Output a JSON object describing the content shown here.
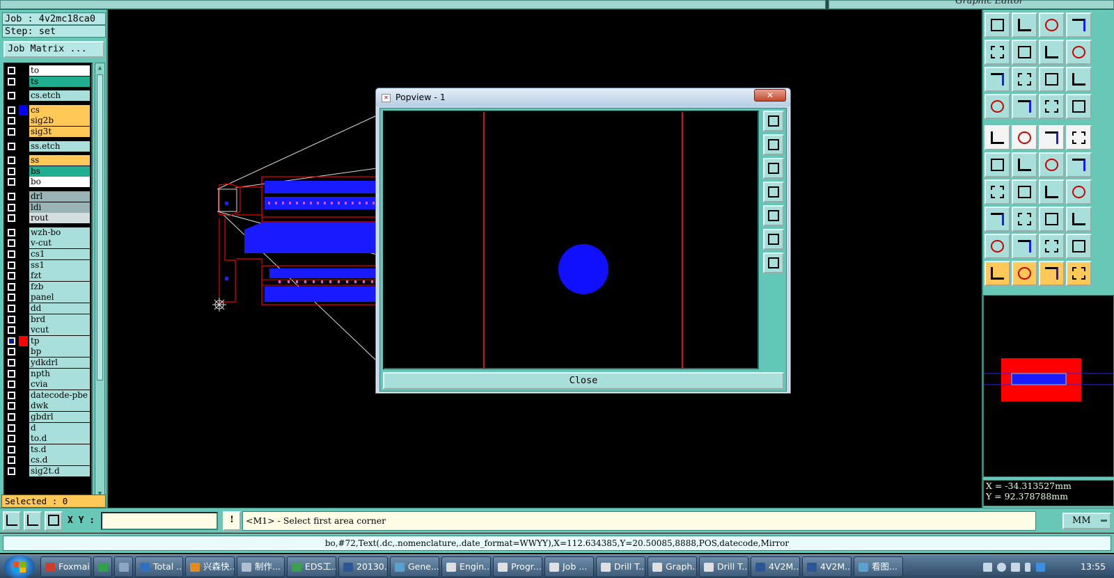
{
  "window": {
    "title": "Graphic Editor"
  },
  "left": {
    "job_line": "Job : 4v2mc18ca0",
    "step_line": "Step: set",
    "job_matrix_button": "Job Matrix ...",
    "selected_line": "Selected : 0",
    "layers": [
      {
        "name": "to",
        "bg": "white",
        "color": "#000000"
      },
      {
        "name": "ts",
        "bg": "green",
        "color": "#000000"
      },
      {
        "name": "cs.etch",
        "bg": "cyan",
        "color": "#000000",
        "gap_before": true
      },
      {
        "name": "cs",
        "bg": "orange",
        "color": "#0000ff",
        "gap_before": true
      },
      {
        "name": "sig2b",
        "bg": "orange",
        "color": "#000000"
      },
      {
        "name": "sig3t",
        "bg": "orange",
        "color": "#000000"
      },
      {
        "name": "ss.etch",
        "bg": "cyan",
        "color": "#000000",
        "gap_before": true
      },
      {
        "name": "ss",
        "bg": "orange",
        "color": "#000000",
        "gap_before": true
      },
      {
        "name": "bs",
        "bg": "green",
        "color": "#000000"
      },
      {
        "name": "bo",
        "bg": "white",
        "color": "#000000"
      },
      {
        "name": "drl",
        "bg": "gray",
        "color": "#000000",
        "gap_before": true
      },
      {
        "name": "ldi",
        "bg": "gray",
        "color": "#000000"
      },
      {
        "name": "rout",
        "bg": "lgray",
        "color": "#000000"
      },
      {
        "name": "wzh-bo",
        "bg": "cyan",
        "color": "#000000",
        "gap_before": true
      },
      {
        "name": "v-cut",
        "bg": "cyan",
        "color": "#000000"
      },
      {
        "name": "cs1",
        "bg": "cyan",
        "color": "#000000"
      },
      {
        "name": "ss1",
        "bg": "cyan",
        "color": "#000000"
      },
      {
        "name": "fzt",
        "bg": "cyan",
        "color": "#000000"
      },
      {
        "name": "fzb",
        "bg": "cyan",
        "color": "#000000"
      },
      {
        "name": "panel",
        "bg": "cyan",
        "color": "#000000"
      },
      {
        "name": "dd",
        "bg": "cyan",
        "color": "#000000"
      },
      {
        "name": "brd",
        "bg": "cyan",
        "color": "#000000"
      },
      {
        "name": "vcut",
        "bg": "cyan",
        "color": "#000000"
      },
      {
        "name": "tp",
        "bg": "cyan",
        "color": "#ff0000",
        "active": true
      },
      {
        "name": "bp",
        "bg": "cyan",
        "color": "#000000"
      },
      {
        "name": "ydkdrl",
        "bg": "cyan",
        "color": "#000000"
      },
      {
        "name": "npth",
        "bg": "cyan",
        "color": "#000000"
      },
      {
        "name": "cvia",
        "bg": "cyan",
        "color": "#000000"
      },
      {
        "name": "datecode-pbe",
        "bg": "cyan",
        "color": "#000000"
      },
      {
        "name": "dwk",
        "bg": "cyan",
        "color": "#000000"
      },
      {
        "name": "gbdrl",
        "bg": "cyan",
        "color": "#000000"
      },
      {
        "name": "d",
        "bg": "cyan",
        "color": "#000000"
      },
      {
        "name": "to.d",
        "bg": "cyan",
        "color": "#000000"
      },
      {
        "name": "ts.d",
        "bg": "cyan",
        "color": "#000000"
      },
      {
        "name": "cs.d",
        "bg": "cyan",
        "color": "#000000"
      },
      {
        "name": "sig2t.d",
        "bg": "cyan",
        "color": "#000000"
      }
    ]
  },
  "popview": {
    "title": "Popview - 1",
    "close_button": "Close",
    "tools": [
      "zoom-window",
      "zoom-in",
      "zoom-out",
      "pan-left",
      "pan-right",
      "fit-screen",
      "fit-height"
    ]
  },
  "right": {
    "coord_x": "X = -34.313527mm",
    "coord_y": "Y = 92.378788mm",
    "tools": [
      {
        "icon": "home-up-icon",
        "style": ""
      },
      {
        "icon": "home-down-icon",
        "style": ""
      },
      {
        "icon": "house-icon",
        "style": ""
      },
      {
        "icon": "window-split-icon",
        "style": ""
      },
      {
        "icon": "pan-left-icon",
        "style": ""
      },
      {
        "icon": "pan-right-icon",
        "style": ""
      },
      {
        "icon": "flip-icon",
        "style": ""
      },
      {
        "icon": "s-curve-icon",
        "style": ""
      },
      {
        "icon": "fit-all-icon",
        "style": ""
      },
      {
        "icon": "center-icon",
        "style": ""
      },
      {
        "icon": "scale-1-2-icon",
        "style": ""
      },
      {
        "icon": "help-icon",
        "style": ""
      },
      {
        "icon": "wrench-icon",
        "style": ""
      },
      {
        "icon": "probe-icon",
        "style": ""
      },
      {
        "icon": "net-a-icon",
        "style": ""
      },
      {
        "icon": "net-b-icon",
        "style": ""
      },
      {
        "icon": "add-pad-icon",
        "style": "white"
      },
      {
        "icon": "polygon-icon",
        "style": "white"
      },
      {
        "icon": "ruler-icon",
        "style": "white"
      },
      {
        "icon": "circle-pad-icon",
        "style": "white"
      },
      {
        "icon": "connect-icon",
        "style": ""
      },
      {
        "icon": "cross-icon",
        "style": ""
      },
      {
        "icon": "link-icon",
        "style": ""
      },
      {
        "icon": "route-icon",
        "style": ""
      },
      {
        "icon": "line-a-icon",
        "style": ""
      },
      {
        "icon": "line-b-icon",
        "style": ""
      },
      {
        "icon": "rotate-icon",
        "style": ""
      },
      {
        "icon": "mirror-icon",
        "style": ""
      },
      {
        "icon": "pad-node-icon",
        "style": ""
      },
      {
        "icon": "segment-icon",
        "style": ""
      },
      {
        "icon": "align-icon",
        "style": ""
      },
      {
        "icon": "group-icon",
        "style": ""
      },
      {
        "icon": "tri-a-icon",
        "style": ""
      },
      {
        "icon": "tri-b-icon",
        "style": ""
      },
      {
        "icon": "tri-c-icon",
        "style": ""
      },
      {
        "icon": "tri-d-icon",
        "style": ""
      },
      {
        "icon": "select-arrow-icon",
        "style": "orange"
      },
      {
        "icon": "select-box-icon",
        "style": "orange"
      },
      {
        "icon": "select-circle-icon",
        "style": "orange"
      },
      {
        "icon": "select-path-icon",
        "style": "orange"
      }
    ]
  },
  "command": {
    "xy_label": "X Y :",
    "xy_value": "",
    "info_button": "!",
    "prompt": "<M1> - Select first area corner",
    "units": "MM"
  },
  "status": {
    "text": "bo,#72,Text(.dc,.nomenclature,.date_format=WWYY),X=112.634385,Y=20.50085,8888,POS,datecode,Mirror"
  },
  "taskbar": {
    "items": [
      {
        "label": "Foxmail",
        "color": "#d03a2a"
      },
      {
        "label": "",
        "color": "#2ea34a"
      },
      {
        "label": "",
        "color": "#8aa6c2"
      },
      {
        "label": "Total ...",
        "color": "#3070c0"
      },
      {
        "label": "兴森快...",
        "color": "#e08a20"
      },
      {
        "label": "制作...",
        "color": "#b0c0d0"
      },
      {
        "label": "EDS工...",
        "color": "#3aa050"
      },
      {
        "label": "20130...",
        "color": "#2b5797"
      },
      {
        "label": "Gene...",
        "color": "#5aa0d0"
      },
      {
        "label": "Engin...",
        "color": "#e0e0e0"
      },
      {
        "label": "Progr...",
        "color": "#e0e0e0"
      },
      {
        "label": "Job ...",
        "color": "#e0e0e0"
      },
      {
        "label": "Drill T...",
        "color": "#e0e0e0"
      },
      {
        "label": "Graph...",
        "color": "#e0e0e0"
      },
      {
        "label": "Drill T...",
        "color": "#e0e0e0"
      },
      {
        "label": "4V2M...",
        "color": "#2b5797"
      },
      {
        "label": "4V2M...",
        "color": "#2b5797"
      },
      {
        "label": "看图...",
        "color": "#5aa0d0"
      }
    ],
    "clock": "13:55"
  }
}
